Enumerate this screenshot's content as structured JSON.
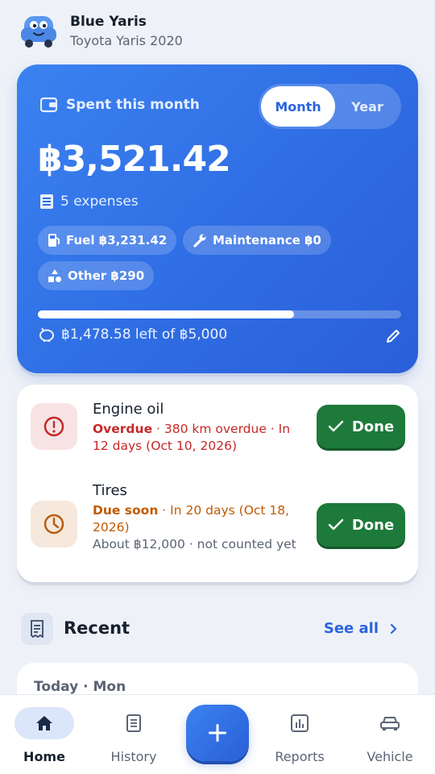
{
  "header": {
    "car_name": "Blue Yaris",
    "car_model": "Toyota Yaris 2020",
    "avatar_icon": "car-mascot-icon"
  },
  "spend_card": {
    "label": "Spent this month",
    "period_options": [
      "Month",
      "Year"
    ],
    "selected_period": "Month",
    "amount": "฿3,521.42",
    "expenses_count": "5 expenses",
    "chips": {
      "fuel": "Fuel ฿3,231.42",
      "maintenance": "Maintenance ฿0",
      "other": "Other ฿290"
    },
    "budget_used_fraction": 0.704,
    "budget_left": "฿1,478.58 left of ฿5,000",
    "accent": "#2f6de4"
  },
  "reminders": [
    {
      "title": "Engine oil",
      "status": "Overdue",
      "detail": " · 380 km overdue · In 12 days (Oct 10, 2026)",
      "note": "",
      "status_color": "#c62828",
      "icon": "alert-circle-icon",
      "button": "Done"
    },
    {
      "title": "Tires",
      "status": "Due soon",
      "detail": " · In 20 days (Oct 18, 2026)",
      "note": "About ฿12,000 · not counted yet",
      "status_color": "#c05a00",
      "icon": "clock-icon",
      "button": "Done"
    }
  ],
  "recent": {
    "title": "Recent",
    "see_all": "See all",
    "today_label": "Today · Mon"
  },
  "nav": {
    "items": [
      "Home",
      "History",
      "Reports",
      "Vehicle"
    ],
    "active": "Home",
    "fab_icon": "plus-icon"
  }
}
